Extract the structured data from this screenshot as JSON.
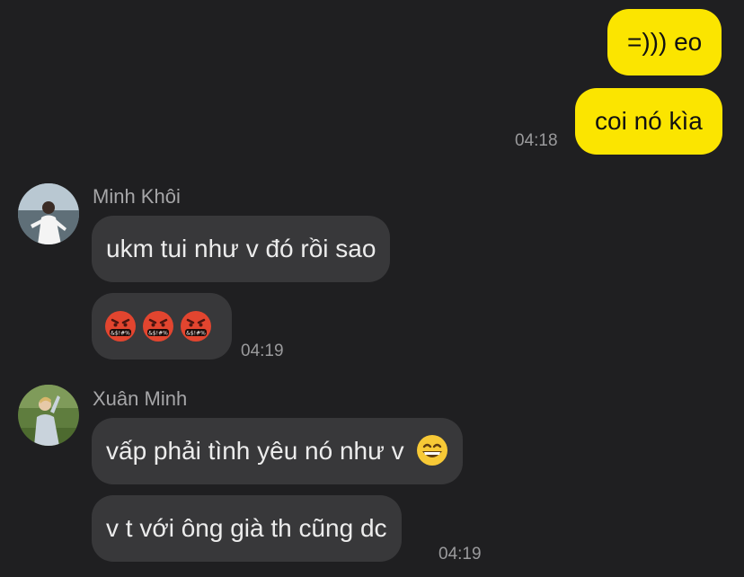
{
  "outgoing": [
    {
      "text": "=))) eo"
    },
    {
      "text": "coi nó kìa",
      "time": "04:18"
    }
  ],
  "groups": [
    {
      "sender": "Minh Khôi",
      "avatar_icon": "profile-photo-man-by-sea",
      "messages": [
        {
          "text": "ukm tui như v đó rồi sao"
        },
        {
          "emojis": [
            "angry-cursing-face",
            "angry-cursing-face",
            "angry-cursing-face"
          ],
          "time": "04:19"
        }
      ]
    },
    {
      "sender": "Xuân Minh",
      "avatar_icon": "profile-photo-person-on-grass",
      "messages": [
        {
          "text": "vấp phải tình yêu nó như v",
          "emoji": "grinning-face"
        },
        {
          "text": "v t với ông già th cũng dc",
          "time": "04:19"
        }
      ]
    }
  ],
  "colors": {
    "background": "#1f1f21",
    "outgoing_bubble": "#fbe500",
    "incoming_bubble": "#38383a",
    "timestamp": "#9a9a9c"
  }
}
